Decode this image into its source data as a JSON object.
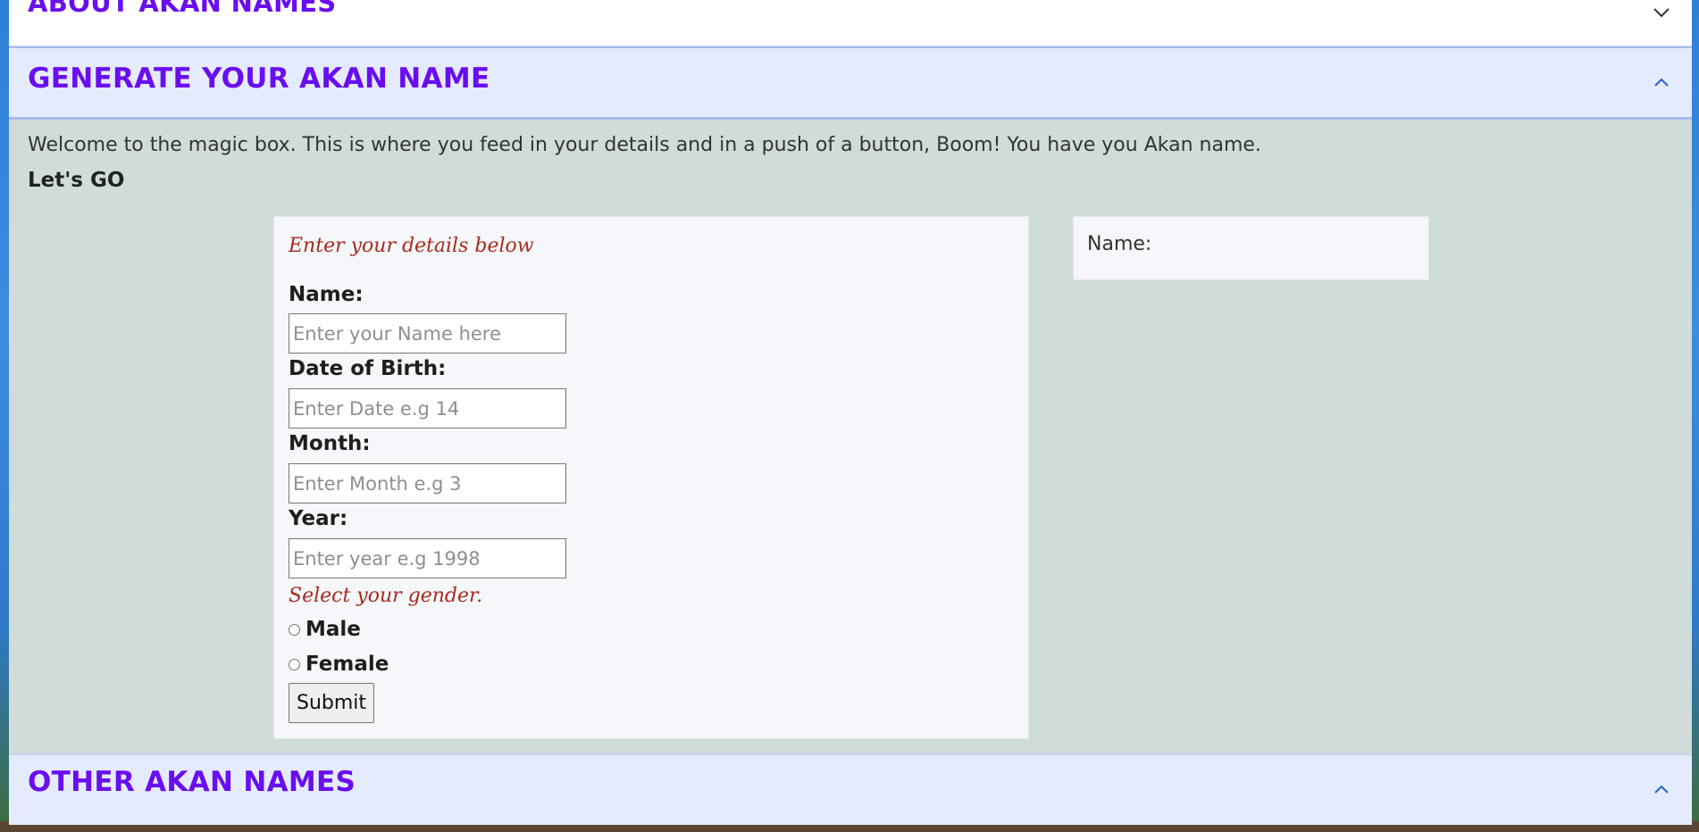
{
  "accordion": {
    "about": {
      "title": "ABOUT AKAN NAMES",
      "icon": "chevron-down-icon"
    },
    "generate": {
      "title": "GENERATE YOUR AKAN NAME",
      "icon": "chevron-up-icon"
    },
    "other": {
      "title": "OTHER AKAN NAMES",
      "icon": "chevron-up-icon"
    }
  },
  "generate_section": {
    "intro": "Welcome to the magic box. This is where you feed in your details and in a push of a button, Boom! You have you Akan name.",
    "lets_go": "Let's GO"
  },
  "form": {
    "heading": "Enter your details below",
    "name_label": "Name:",
    "name_placeholder": "Enter your Name here",
    "name_value": "",
    "date_label": "Date of Birth:",
    "date_placeholder": "Enter Date e.g 14",
    "date_value": "",
    "month_label": "Month:",
    "month_placeholder": "Enter Month e.g 3",
    "month_value": "",
    "year_label": "Year:",
    "year_placeholder": "Enter year e.g 1998",
    "year_value": "",
    "gender_prompt": "Select your gender.",
    "male_label": "Male",
    "female_label": "Female",
    "submit_label": "Submit"
  },
  "result": {
    "name_label": "Name:"
  },
  "colors": {
    "accent_heading": "#6a0ef0",
    "hint_text": "#a92a1c",
    "section_body_bg": "#cfdcd9",
    "header_bg": "#e4ebfc"
  }
}
